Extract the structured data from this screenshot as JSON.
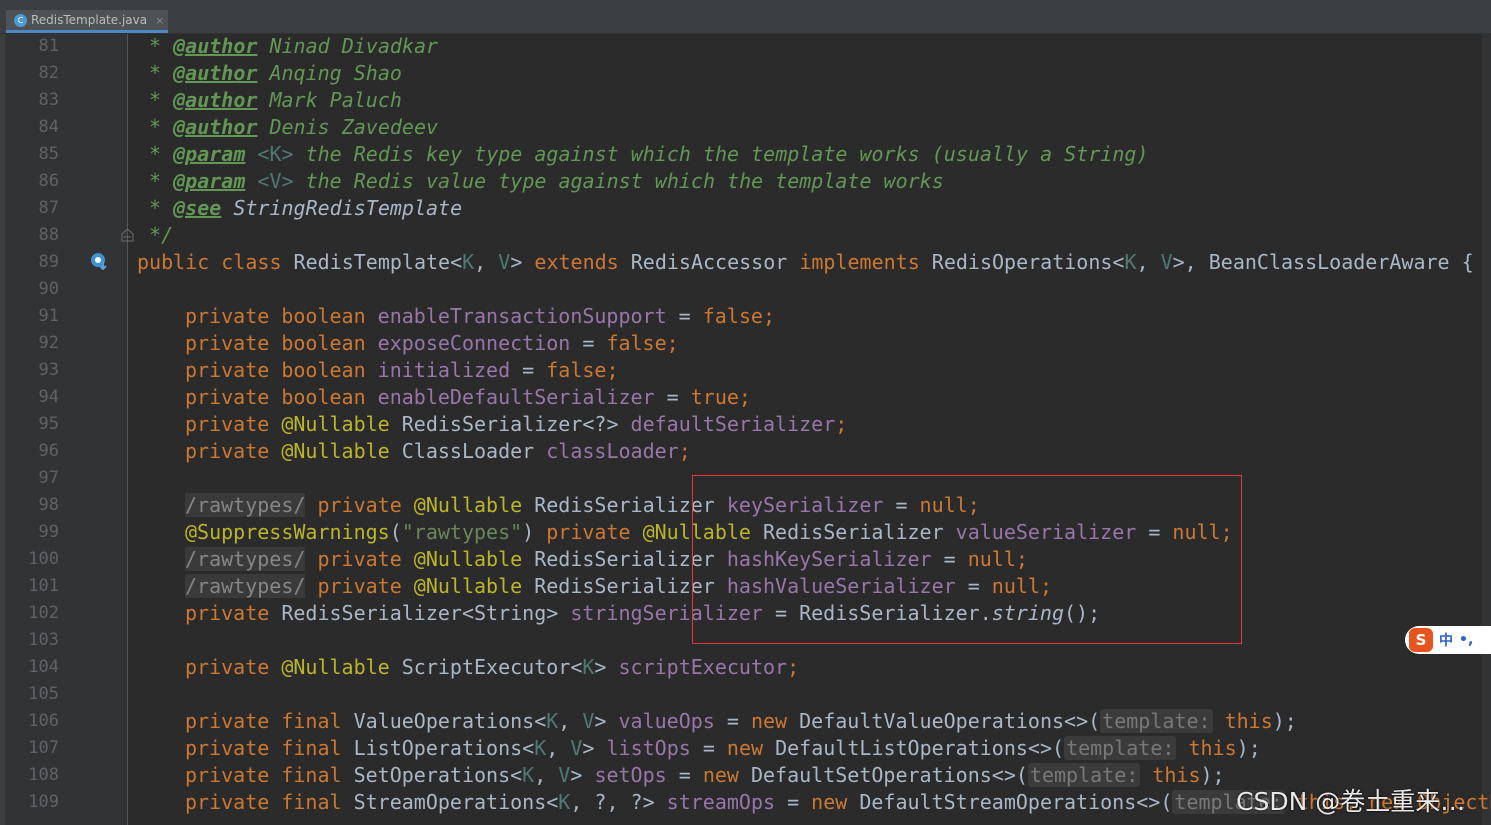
{
  "editor": {
    "tab": {
      "filename": "RedisTemplate.java",
      "close": "×",
      "file_icon": "C"
    },
    "line_numbers": [
      "81",
      "82",
      "83",
      "84",
      "85",
      "86",
      "87",
      "88",
      "89",
      "90",
      "91",
      "92",
      "93",
      "94",
      "95",
      "96",
      "97",
      "98",
      "99",
      "100",
      "101",
      "102",
      "103",
      "104",
      "105",
      "106",
      "107",
      "108",
      "109"
    ],
    "tokens": {
      "l81_star": " * ",
      "l81_tag": "@author",
      "l81_text": " Ninad Divadkar",
      "l82_star": " * ",
      "l82_tag": "@author",
      "l82_text": " Anqing Shao",
      "l83_star": " * ",
      "l83_tag": "@author",
      "l83_text": " Mark Paluch",
      "l84_star": " * ",
      "l84_tag": "@author",
      "l84_text": " Denis Zavedeev",
      "l85_star": " * ",
      "l85_tag": "@param",
      "l85_tp": " <K>",
      "l85_text": " the Redis key type against which the template works (usually a String)",
      "l86_star": " * ",
      "l86_tag": "@param",
      "l86_tp": " <V>",
      "l86_text": " the Redis value type against which the template works",
      "l87_star": " * ",
      "l87_tag": "@see",
      "l87_text": " StringRedisTemplate",
      "l88_end": " */",
      "l89_kw1": "public class",
      "l89_name": " RedisTemplate<",
      "l89_k": "K",
      "l89_c1": ", ",
      "l89_v": "V",
      "l89_c2": "> ",
      "l89_ext": "extends",
      "l89_base": " RedisAccessor ",
      "l89_impl": "implements",
      "l89_iface": " RedisOperations<",
      "l89_k2": "K",
      "l89_c3": ", ",
      "l89_v2": "V",
      "l89_rest": ">, BeanClassLoaderAware {",
      "l91_kw": "private boolean ",
      "l91_f": "enableTransactionSupport",
      "l91_eq": " = ",
      "l91_v": "false",
      "l91_sc": ";",
      "l92_kw": "private boolean ",
      "l92_f": "exposeConnection",
      "l92_eq": " = ",
      "l92_v": "false",
      "l92_sc": ";",
      "l93_kw": "private boolean ",
      "l93_f": "initialized",
      "l93_eq": " = ",
      "l93_v": "false",
      "l93_sc": ";",
      "l94_kw": "private boolean ",
      "l94_f": "enableDefaultSerializer",
      "l94_eq": " = ",
      "l94_v": "true",
      "l94_sc": ";",
      "l95_kw": "private ",
      "l95_ann": "@Nullable",
      "l95_t": " RedisSerializer<?> ",
      "l95_f": "defaultSerializer",
      "l95_sc": ";",
      "l96_kw": "private ",
      "l96_ann": "@Nullable",
      "l96_t": " ClassLoader ",
      "l96_f": "classLoader",
      "l96_sc": ";",
      "l98_raw": "/rawtypes/",
      "l98_kw": " private ",
      "l98_ann": "@Nullable",
      "l98_t": " RedisSerializer ",
      "l98_f": "keySerializer",
      "l98_eq": " = ",
      "l98_v": "null",
      "l98_sc": ";",
      "l99_ann": "@SuppressWarnings",
      "l99_p1": "(",
      "l99_str": "\"rawtypes\"",
      "l99_p2": ") ",
      "l99_kw": "private ",
      "l99_ann2": "@Nullable",
      "l99_t": " RedisSerializer ",
      "l99_f": "valueSerializer",
      "l99_eq": " = ",
      "l99_v": "null",
      "l99_sc": ";",
      "l100_raw": "/rawtypes/",
      "l100_kw": " private ",
      "l100_ann": "@Nullable",
      "l100_t": " RedisSerializer ",
      "l100_f": "hashKeySerializer",
      "l100_eq": " = ",
      "l100_v": "null",
      "l100_sc": ";",
      "l101_raw": "/rawtypes/",
      "l101_kw": " private ",
      "l101_ann": "@Nullable",
      "l101_t": " RedisSerializer ",
      "l101_f": "hashValueSerializer",
      "l101_eq": " = ",
      "l101_v": "null",
      "l101_sc": ";",
      "l102_kw": "private ",
      "l102_t": "RedisSerializer<String> ",
      "l102_f": "stringSerializer",
      "l102_eq": " = RedisSerializer.",
      "l102_m": "string",
      "l102_end": "();",
      "l104_kw": "private ",
      "l104_ann": "@Nullable",
      "l104_t": " ScriptExecutor<",
      "l104_k": "K",
      "l104_c": "> ",
      "l104_f": "scriptExecutor",
      "l104_sc": ";",
      "l106_kw": "private final ",
      "l106_t": "ValueOperations<",
      "l106_k": "K",
      "l106_c": ", ",
      "l106_v": "V",
      "l106_c2": "> ",
      "l106_f": "valueOps",
      "l106_eq": " = ",
      "l106_new": "new",
      "l106_ctor": " DefaultValueOperations<>(",
      "l106_hint": "template:",
      "l106_this": " this",
      "l106_end": ");",
      "l107_kw": "private final ",
      "l107_t": "ListOperations<",
      "l107_k": "K",
      "l107_c": ", ",
      "l107_v": "V",
      "l107_c2": "> ",
      "l107_f": "listOps",
      "l107_eq": " = ",
      "l107_new": "new",
      "l107_ctor": " DefaultListOperations<>(",
      "l107_hint": "template:",
      "l107_this": " this",
      "l107_end": ");",
      "l108_kw": "private final ",
      "l108_t": "SetOperations<",
      "l108_k": "K",
      "l108_c": ", ",
      "l108_v": "V",
      "l108_c2": "> ",
      "l108_f": "setOps",
      "l108_eq": " = ",
      "l108_new": "new",
      "l108_ctor": " DefaultSetOperations<>(",
      "l108_hint": "template:",
      "l108_this": " this",
      "l108_end": ");",
      "l109_kw": "private final ",
      "l109_t": "StreamOperations<",
      "l109_k": "K",
      "l109_c": ", ?, ?> ",
      "l109_f": "streamOps",
      "l109_eq": " = ",
      "l109_new": "new",
      "l109_ctor": " DefaultStreamOperations<>(",
      "l109_hint": "template:",
      "l109_rest": " this, new ObjectHa"
    }
  },
  "ime": {
    "logo": "S",
    "lang": "中",
    "punct": "•,"
  },
  "watermark": "CSDN @卷土重来…",
  "colors": {
    "background": "#2b2b2b",
    "keyword": "#cc7832",
    "field": "#9876aa",
    "comment": "#629755",
    "annotation": "#bbb529",
    "highlight_box": "#e0383d"
  }
}
